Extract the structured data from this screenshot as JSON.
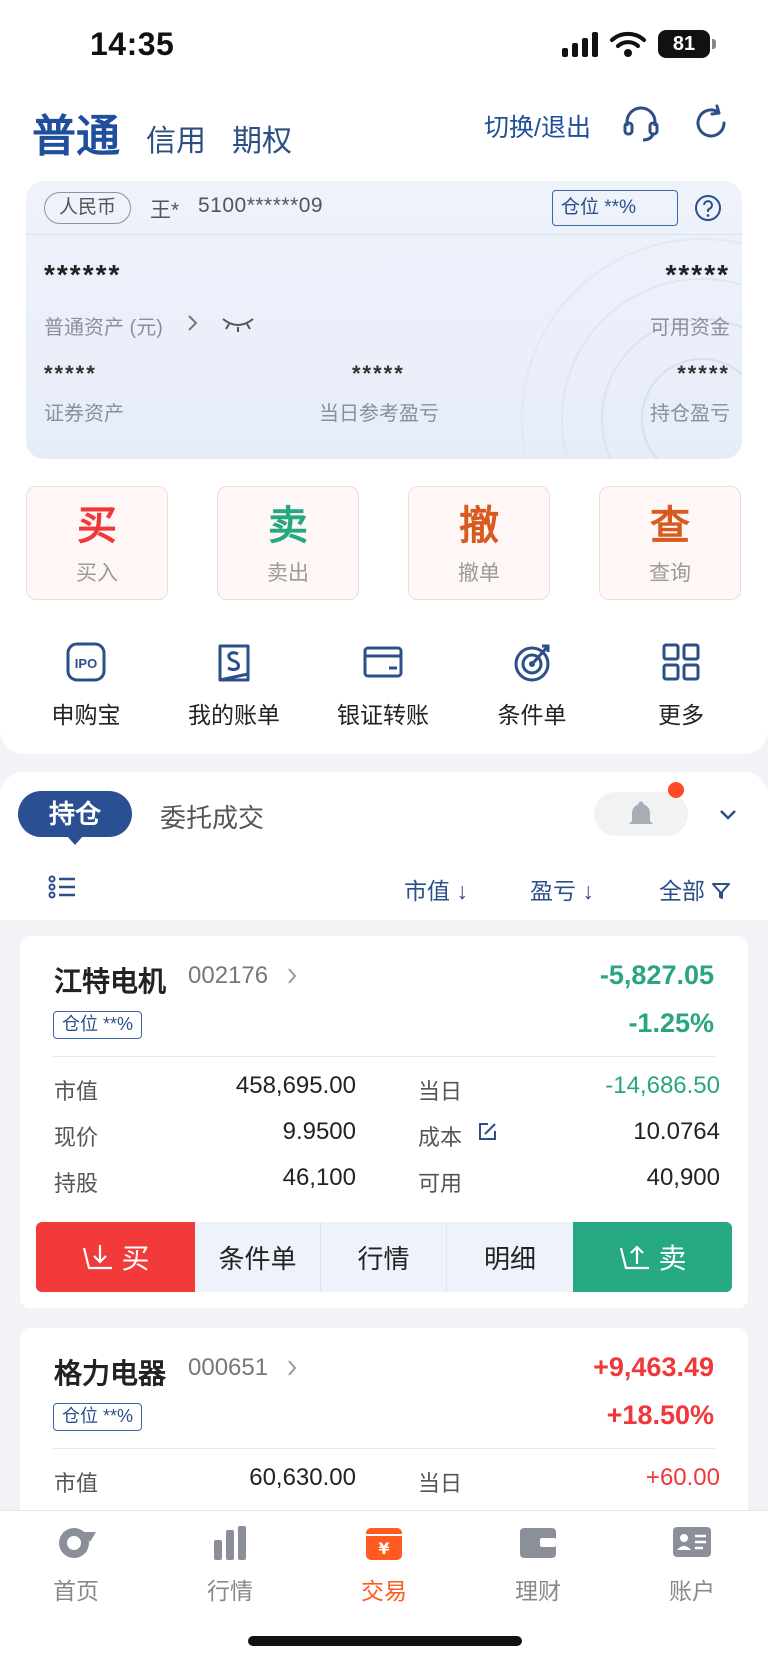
{
  "status_bar": {
    "time": "14:35",
    "battery": "81"
  },
  "header": {
    "tabs": [
      {
        "label": "普通",
        "active": true
      },
      {
        "label": "信用",
        "active": false
      },
      {
        "label": "期权",
        "active": false
      }
    ],
    "switch_label": "切换/退出"
  },
  "asset_card": {
    "currency": "人民币",
    "account_name": "王*",
    "account_no": "5100******09",
    "position_badge": "仓位 **%",
    "total_assets_masked": "******",
    "total_assets_label": "普通资产 (元)",
    "available_funds_masked": "*****",
    "available_funds_label": "可用资金",
    "securities_masked": "*****",
    "securities_label": "证券资产",
    "daily_pl_masked": "*****",
    "daily_pl_label": "当日参考盈亏",
    "holding_pl_masked": "*****",
    "holding_pl_label": "持仓盈亏"
  },
  "actions": [
    {
      "big": "买",
      "small": "买入",
      "color": "#f0373a"
    },
    {
      "big": "卖",
      "small": "卖出",
      "color": "#26a882"
    },
    {
      "big": "撤",
      "small": "撤单",
      "color": "#d85a20"
    },
    {
      "big": "查",
      "small": "查询",
      "color": "#d85a20"
    }
  ],
  "quick_links": [
    {
      "label": "申购宝",
      "icon": "ipo-icon"
    },
    {
      "label": "我的账单",
      "icon": "bill-icon"
    },
    {
      "label": "银证转账",
      "icon": "card-icon"
    },
    {
      "label": "条件单",
      "icon": "target-icon"
    },
    {
      "label": "更多",
      "icon": "grid-icon"
    }
  ],
  "holdings_tabs": {
    "active": "持仓",
    "other": "委托成交"
  },
  "sort_bar": {
    "market_value": "市值 ↓",
    "pl": "盈亏 ↓",
    "all": "全部"
  },
  "holdings": [
    {
      "name": "江特电机",
      "code": "002176",
      "position": "仓位 **%",
      "pl": "-5,827.05",
      "pl_pct": "-1.25%",
      "market_value_label": "市值",
      "market_value": "458,695.00",
      "today_label": "当日",
      "today": "-14,686.50",
      "price_label": "现价",
      "price": "9.9500",
      "cost_label": "成本",
      "cost": "10.0764",
      "shares_label": "持股",
      "shares": "46,100",
      "available_label": "可用",
      "available": "40,900",
      "buttons": {
        "buy": "买",
        "conditional": "条件单",
        "quote": "行情",
        "detail": "明细",
        "sell": "卖"
      }
    },
    {
      "name": "格力电器",
      "code": "000651",
      "position": "仓位 **%",
      "pl": "+9,463.49",
      "pl_pct": "+18.50%",
      "market_value_label": "市值",
      "market_value": "60,630.00",
      "today_label": "当日",
      "today": "+60.00"
    }
  ],
  "bottom_nav": [
    {
      "label": "首页",
      "icon": "home-icon",
      "active": false
    },
    {
      "label": "行情",
      "icon": "chart-icon",
      "active": false
    },
    {
      "label": "交易",
      "icon": "trade-icon",
      "active": true
    },
    {
      "label": "理财",
      "icon": "wallet-icon",
      "active": false
    },
    {
      "label": "账户",
      "icon": "account-icon",
      "active": false
    }
  ],
  "colors": {
    "brand": "#1f4f9c",
    "up": "#f0373a",
    "down": "#2aa583",
    "active_nav": "#ff5a1f"
  }
}
